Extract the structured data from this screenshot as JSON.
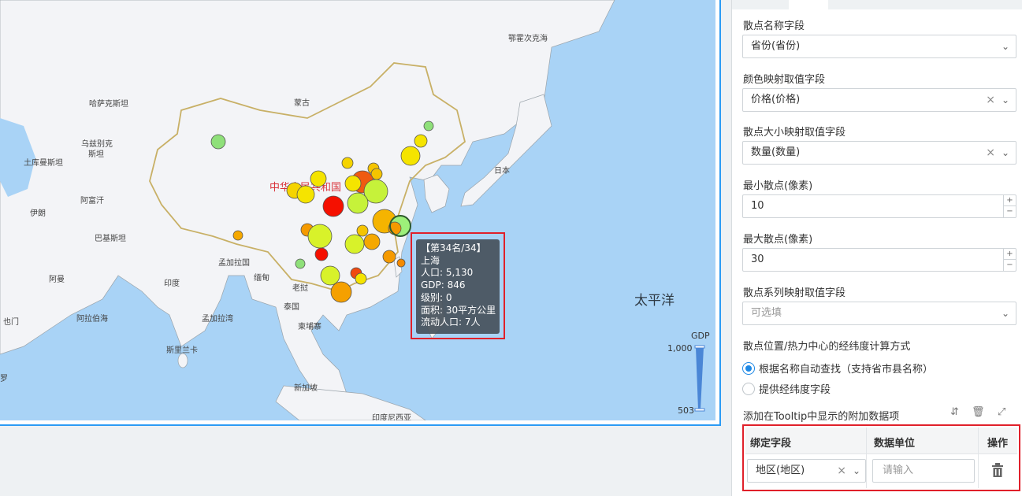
{
  "map": {
    "labels": {
      "kazakhstan": "哈萨克斯坦",
      "russia": "鄂霍次克海",
      "mongolia": "蒙古",
      "uzbekistan_1": "乌兹别克",
      "uzbekistan_2": "斯坦",
      "turkmenistan": "土库曼斯坦",
      "iran": "伊朗",
      "afghanistan": "阿富汗",
      "pakistan": "巴基斯坦",
      "oman": "阿曼",
      "india": "印度",
      "bangladesh": "孟加拉国",
      "myanmar": "缅甸",
      "laos": "老挝",
      "thailand": "泰国",
      "cambodia": "柬埔寨",
      "yemen": "也门",
      "arabian_sea": "阿拉伯海",
      "bay_of_bengal": "孟加拉湾",
      "sri_lanka": "斯里兰卡",
      "singapore": "新加坡",
      "indonesia": "印度尼西亚",
      "japan": "日本",
      "china": "中华人民共和国",
      "pacific": "太平洋",
      "left_edge": "罗"
    },
    "legend": {
      "title": "GDP",
      "max": "1,000",
      "min": "503"
    },
    "colors": {
      "ocean": "#a9d3f6",
      "land": "#f3f4f7",
      "border": "#c8b066",
      "frame": "#2b9bf4"
    }
  },
  "tooltip": {
    "rank": "【第34名/34】",
    "name": "上海",
    "population": "人口: 5,130",
    "gdp": "GDP: 846",
    "level": "级别: 0",
    "area": "面积: 30平方公里",
    "floating": "流动人口: 7人"
  },
  "panel": {
    "scatter_name_label": "散点名称字段",
    "scatter_name_value": "省份(省份)",
    "color_label": "颜色映射取值字段",
    "color_value": "价格(价格)",
    "size_label": "散点大小映射取值字段",
    "size_value": "数量(数量)",
    "min_label": "最小散点(像素)",
    "min_value": "10",
    "max_label": "最大散点(像素)",
    "max_value": "30",
    "series_label": "散点系列映射取值字段",
    "series_placeholder": "可选填",
    "method_label": "散点位置/热力中心的经纬度计算方式",
    "method_auto": "根据名称自动查找（支持省市县名称）",
    "method_manual": "提供经纬度字段",
    "tooltip_extra_label": "添加在Tooltip中显示的附加数据项",
    "table": {
      "col_field": "绑定字段",
      "col_unit": "数据单位",
      "col_action": "操作",
      "row_field": "地区(地区)",
      "row_unit_placeholder": "请输入"
    },
    "accent": "#1e88e5"
  }
}
